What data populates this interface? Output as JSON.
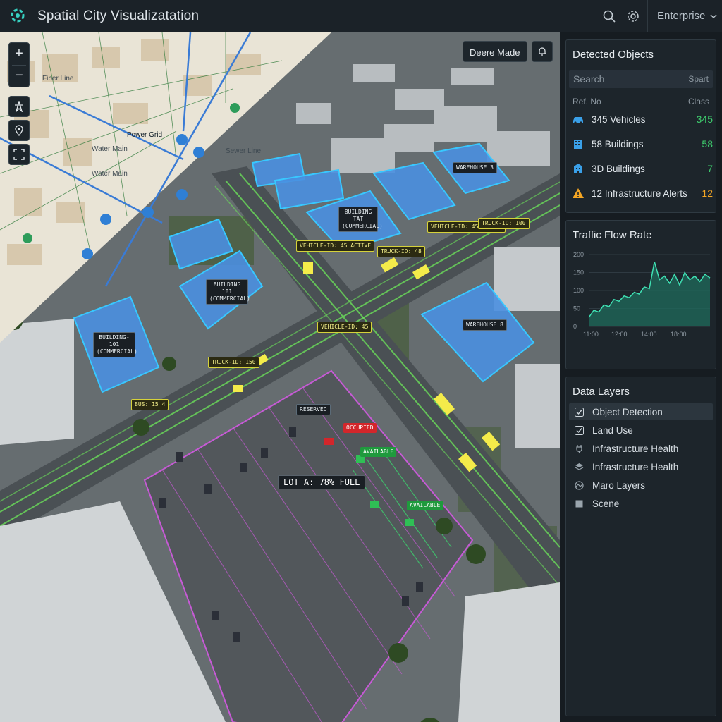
{
  "app": {
    "title": "Spatial City Visualizatation",
    "tenant": "Enterprise"
  },
  "topbar": {
    "icons": [
      "search-icon",
      "gear-icon",
      "chevron-down-icon"
    ]
  },
  "map": {
    "mode_button": "Deere Made",
    "parking_summary": "LOT A: 78% FULL",
    "building_tags": [
      "BUILDING-101 (COMMERCIAL)",
      "BUILDING 101 (COMMERCIAL)",
      "WAREHOUSE 3",
      "BUILDING TAT (COMMERCIAL)",
      "WAREHOUSE 8"
    ],
    "vehicle_tags": [
      "VEHICLE-ID: 45 ACTIVE",
      "TRUCK-ID: 48",
      "VEHICLE-ID: 45 LIGHTS",
      "TRUCK-ID: 100",
      "TRUCK-ID: 150",
      "VEHICLE-ID: 45",
      "BUS: 15 4"
    ],
    "parking_tags": {
      "occupied": "OCCUPIED",
      "available": "AVAILABLE",
      "available2": "AVAILABLE",
      "reserved": "RESERVED"
    },
    "overlay_labels": [
      "Power Grid",
      "Water Main",
      "Fiber Line",
      "Power Grid",
      "Water Main",
      "Sewer Line"
    ]
  },
  "detected_objects": {
    "title": "Detected Objects",
    "search_placeholder": "Search",
    "search_right": "Spart",
    "col_ref": "Ref. No",
    "col_class": "Class",
    "rows": [
      {
        "label": "345 Vehicles",
        "count": "345",
        "color": "#3ecf6e",
        "icon": "car-icon"
      },
      {
        "label": "58 Buildings",
        "count": "58",
        "color": "#3ecf6e",
        "icon": "building-icon"
      },
      {
        "label": "3D Buildings",
        "count": "7",
        "color": "#3ecf6e",
        "icon": "building-3d-icon"
      },
      {
        "label": "12 Infrastructure Alerts",
        "count": "12",
        "color": "#f5a623",
        "icon": "warning-icon"
      }
    ]
  },
  "traffic": {
    "title": "Traffic Flow Rate",
    "y_ticks": [
      "200",
      "150",
      "100",
      "50",
      "0"
    ],
    "x_ticks": [
      "11:00",
      "12:00",
      "14:00",
      "18:00"
    ],
    "chart_data": {
      "type": "area",
      "title": "Traffic Flow Rate",
      "xlabel": "",
      "ylabel": "",
      "ylim": [
        0,
        200
      ],
      "x_tick_labels": [
        "11:00",
        "12:00",
        "14:00",
        "18:00"
      ],
      "values": [
        25,
        45,
        40,
        60,
        55,
        75,
        70,
        85,
        80,
        95,
        90,
        110,
        105,
        180,
        130,
        140,
        120,
        145,
        115,
        150,
        130,
        140,
        125,
        145,
        135
      ]
    }
  },
  "data_layers": {
    "title": "Data Layers",
    "items": [
      {
        "label": "Object Detection",
        "icon": "checkbox-checked-icon",
        "active": true
      },
      {
        "label": "Land Use",
        "icon": "checkbox-checked-icon",
        "active": false
      },
      {
        "label": "Infrastructure Health",
        "icon": "plug-icon",
        "active": false
      },
      {
        "label": "Infrastructure Health",
        "icon": "layers-icon",
        "active": false
      },
      {
        "label": "Maro Layers",
        "icon": "map-layers-icon",
        "active": false
      },
      {
        "label": "Scene",
        "icon": "square-icon",
        "active": false
      }
    ]
  }
}
